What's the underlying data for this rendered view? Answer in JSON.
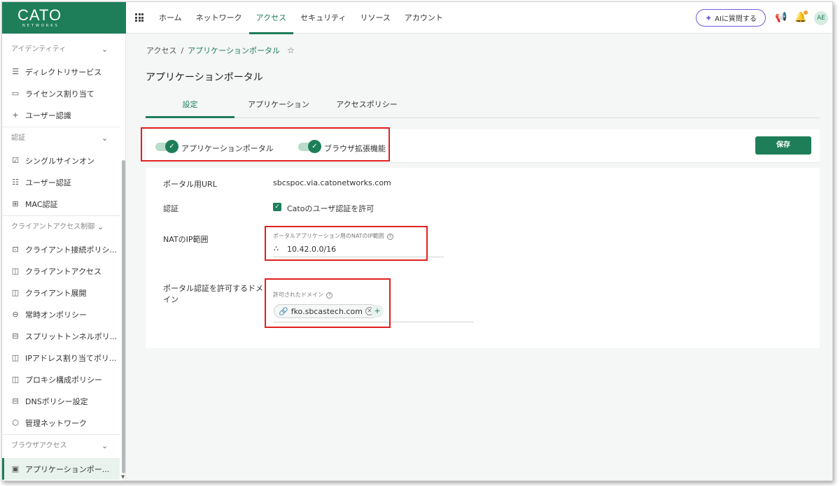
{
  "logo": {
    "brand": "CATO",
    "sub": "NETWORKS"
  },
  "nav": {
    "items": [
      "ホーム",
      "ネットワーク",
      "アクセス",
      "セキュリティ",
      "リソース",
      "アカウント"
    ],
    "active": "アクセス"
  },
  "header": {
    "ai_button": "AIに質問する",
    "avatar": "AE"
  },
  "icons": {
    "apps": "grid-icon",
    "megaphone": "megaphone-icon",
    "bell": "bell-icon"
  },
  "sidebar": {
    "sections": [
      {
        "title": "アイデンティティ",
        "items": [
          "ディレクトリサービス",
          "ライセンス割り当て",
          "ユーザー認識"
        ]
      },
      {
        "title": "認証",
        "items": [
          "シングルサインオン",
          "ユーザー認証",
          "MAC認証"
        ]
      },
      {
        "title": "クライアントアクセス制御",
        "items": [
          "クライアント接続ポリシ...",
          "クライアントアクセス",
          "クライアント展開",
          "常時オンポリシー",
          "スプリットトンネルポリ...",
          "IPアドレス割り当てポリ...",
          "プロキシ構成ポリシー",
          "DNSポリシー設定",
          "管理ネットワーク"
        ]
      },
      {
        "title": "ブラウザアクセス",
        "items": [
          "アプリケーションポー..."
        ]
      }
    ]
  },
  "breadcrumb": {
    "root": "アクセス",
    "separator": "/",
    "current": "アプリケーションポータル"
  },
  "page": {
    "title": "アプリケーションポータル"
  },
  "tabs": [
    "設定",
    "アプリケーション",
    "アクセスポリシー"
  ],
  "toggles": {
    "portal": "アプリケーションポータル",
    "browser_ext": "ブラウザ拡張機能"
  },
  "save_label": "保存",
  "form": {
    "portal_url_label": "ポータル用URL",
    "portal_url_value": "sbcspoc.via.catonetworks.com",
    "auth_label": "認証",
    "auth_checkbox": "Catoのユーザ認証を許可",
    "nat_label": "NATのIP範囲",
    "nat_field_label": "ポータルアプリケーション用のNATのIP範囲",
    "nat_value": "10.42.0.0/16",
    "domain_label": "ポータル認証を許可するドメイン",
    "domain_field_label": "許可されたドメイン",
    "domain_chip": "fko.sbcastech.com"
  }
}
